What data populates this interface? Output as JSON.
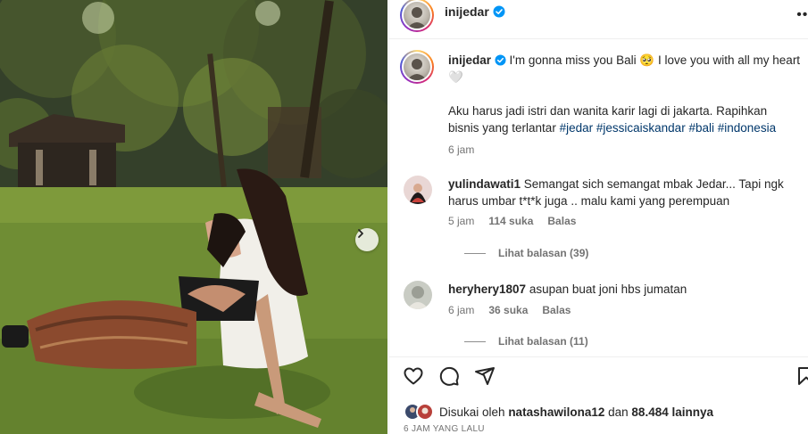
{
  "post": {
    "username": "inijedar",
    "more_label": "•••"
  },
  "caption": {
    "username": "inijedar",
    "text_main": "I'm gonna miss you Bali 🥺 I love you with all my heart🤍",
    "text_line2": "Aku harus jadi istri dan wanita karir lagi di jakarta. Rapihkan bisnis yang terlantar",
    "hashtags": [
      "#jedar",
      "#jessicaiskandar",
      "#bali",
      "#indonesia"
    ],
    "time": "6 jam"
  },
  "comments": [
    {
      "username": "yulindawati1",
      "text": "Semangat sich semangat mbak Jedar... Tapi ngk harus umbar t*t*k juga .. malu kami yang perempuan",
      "time": "5 jam",
      "likes": "114 suka",
      "reply_label": "Balas",
      "view_replies": "Lihat balasan (39)"
    },
    {
      "username": "heryhery1807",
      "text": "asupan buat joni hbs jumatan",
      "time": "6 jam",
      "likes": "36 suka",
      "reply_label": "Balas",
      "view_replies": "Lihat balasan (11)"
    }
  ],
  "likes": {
    "prefix": "Disukai oleh",
    "user": "natashawilona12",
    "middle": "dan",
    "count": "88.484 lainnya"
  },
  "posted_ago": "6 JAM YANG LALU",
  "icons": {
    "verified": "verified-badge-icon",
    "like": "heart-icon",
    "comment": "comment-bubble-icon",
    "share": "paper-plane-icon",
    "save": "bookmark-icon",
    "next": "chevron-right-icon"
  },
  "colors": {
    "verified": "#0095f6",
    "hashtag": "#00376b",
    "muted": "#737373"
  }
}
